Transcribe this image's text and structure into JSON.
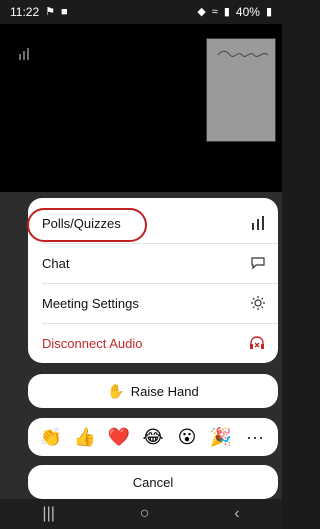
{
  "status": {
    "time": "11:22",
    "battery": "40%"
  },
  "menu": {
    "items": [
      {
        "label": "Polls/Quizzes",
        "color": "#111111",
        "icon": "bar-chart-icon"
      },
      {
        "label": "Chat",
        "color": "#111111",
        "icon": "chat-bubble-icon"
      },
      {
        "label": "Meeting Settings",
        "color": "#111111",
        "icon": "gear-icon"
      },
      {
        "label": "Disconnect Audio",
        "color": "#c62828",
        "icon": "headset-x-icon"
      }
    ]
  },
  "raise_hand": {
    "label": "Raise Hand",
    "icon": "hand-icon"
  },
  "reactions": [
    {
      "glyph": "👏",
      "icon": "clap-icon"
    },
    {
      "glyph": "👍",
      "icon": "thumbs-up-icon"
    },
    {
      "glyph": "❤️",
      "icon": "heart-icon"
    },
    {
      "glyph": "😂",
      "icon": "tears-of-joy-icon"
    },
    {
      "glyph": "😮",
      "icon": "surprised-icon"
    },
    {
      "glyph": "🎉",
      "icon": "party-icon"
    }
  ],
  "more_label": "···",
  "cancel_label": "Cancel",
  "accent": {
    "danger": "#c62828",
    "highlight": "#c02020"
  }
}
